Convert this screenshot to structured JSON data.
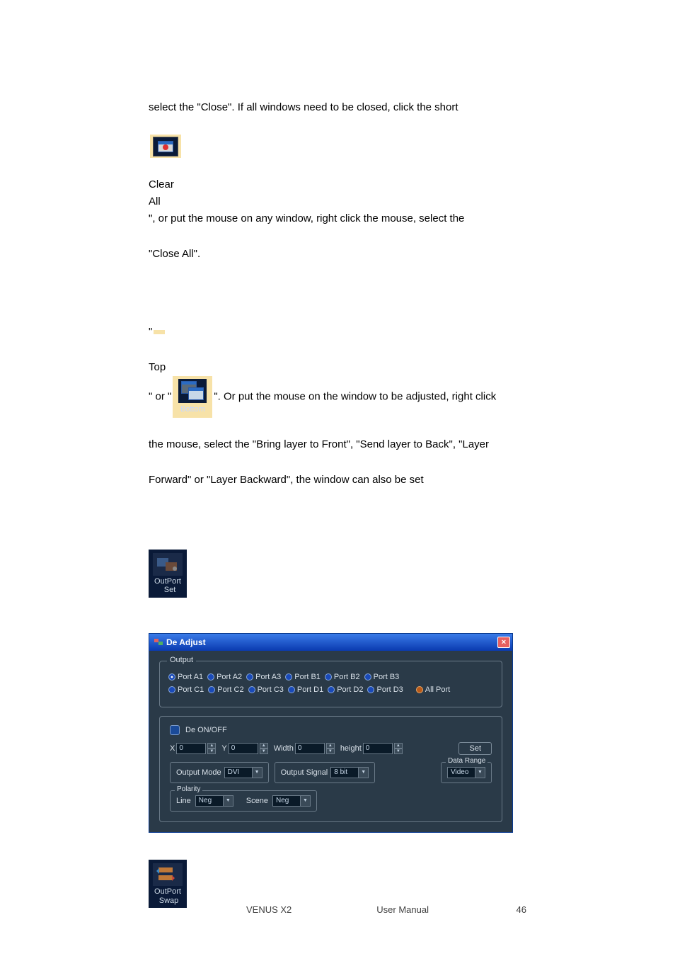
{
  "paragraphs": {
    "p1": "select the \"Close\". If all windows need to be closed, click the short",
    "p2_prefix": "\"",
    "p2_suffix": "\", or put the mouse on any window, right click the mouse, select the",
    "p3": "\"Close All\".",
    "p4_a": "\"",
    "p4_b": "\" or \"",
    "p4_c": "\". Or put the mouse on the window to be adjusted, right click",
    "p5": "the mouse, select the \"Bring layer to Front\", \"Send layer to Back\", \"Layer",
    "p6": "Forward\" or \"Layer Backward\", the window can also be set"
  },
  "toolbar": {
    "clearall_line1": "Clear",
    "clearall_line2": "All",
    "top_label": "Top",
    "bottom_label": "Bottom"
  },
  "outport_set": {
    "label": "OutPort\n  Set"
  },
  "outport_swap": {
    "label": "OutPort\n Swap"
  },
  "dialog": {
    "title": "De Adjust",
    "close_glyph": "×",
    "output_legend": "Output",
    "ports_row1": [
      "Port A1",
      "Port A2",
      "Port A3",
      "Port B1",
      "Port B2",
      "Port B3"
    ],
    "ports_row2": [
      "Port C1",
      "Port C2",
      "Port C3",
      "Port D1",
      "Port D2",
      "Port D3"
    ],
    "all_port": "All Port",
    "de_onoff": "De ON/OFF",
    "x_label": "X",
    "y_label": "Y",
    "width_label": "Width",
    "height_label": "height",
    "x_val": "0",
    "y_val": "0",
    "w_val": "0",
    "h_val": "0",
    "set_btn": "Set",
    "output_mode_label": "Output Mode",
    "output_mode_val": "DVI",
    "output_signal_label": "Output Signal",
    "output_signal_val": "8 bit",
    "data_range_legend": "Data Range",
    "data_range_val": "Video",
    "polarity_legend": "Polarity",
    "line_label": "Line",
    "line_val": "Neg",
    "scene_label": "Scene",
    "scene_val": "Neg"
  },
  "footer": {
    "product": "VENUS X2",
    "doctype": "User Manual",
    "page": "46"
  }
}
